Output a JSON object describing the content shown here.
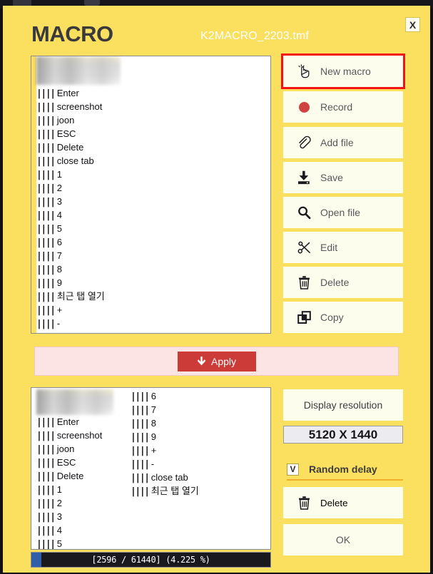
{
  "window": {
    "app_title": "MACRO",
    "file_name": "K2MACRO_2203.tmf",
    "close_label": "X"
  },
  "macro_list_top": {
    "bars": "||||",
    "items": [
      "Enter",
      "screenshot",
      "joon",
      "ESC",
      "Delete",
      "close tab",
      "1",
      "2",
      "3",
      "4",
      "5",
      "6",
      "7",
      "8",
      "9",
      "최근 탭 열기",
      "+",
      "-"
    ]
  },
  "macro_list_bottom": {
    "bars": "||||",
    "left_column": [
      "Enter",
      "screenshot",
      "joon",
      "ESC",
      "Delete",
      "1",
      "2",
      "3",
      "4",
      "5"
    ],
    "right_column": [
      "6",
      "7",
      "8",
      "9",
      "+",
      "-",
      "close tab",
      "최근 탭 열기"
    ]
  },
  "status": {
    "text": "[2596 / 61440] (4.225 %)",
    "current": 2596,
    "total": 61440,
    "percent": 4.225
  },
  "actions": [
    {
      "label": "New macro",
      "icon": "pointer-hand-icon",
      "highlighted": true
    },
    {
      "label": "Record",
      "icon": "record-dot-icon",
      "highlighted": false
    },
    {
      "label": "Add file",
      "icon": "paperclip-icon",
      "highlighted": false
    },
    {
      "label": "Save",
      "icon": "save-download-icon",
      "highlighted": false
    },
    {
      "label": "Open file",
      "icon": "magnifier-icon",
      "highlighted": false
    },
    {
      "label": "Edit",
      "icon": "scissors-icon",
      "highlighted": false
    },
    {
      "label": "Delete",
      "icon": "trash-icon",
      "highlighted": false
    },
    {
      "label": "Copy",
      "icon": "copy-squares-icon",
      "highlighted": false
    }
  ],
  "apply": {
    "label": "Apply",
    "icon": "down-arrow-icon"
  },
  "display": {
    "resolution_button_label": "Display resolution",
    "resolution_value": "5120 X 1440"
  },
  "random_delay": {
    "label": "Random delay",
    "checkbox_mark": "V",
    "checked": true
  },
  "bottom_actions": {
    "delete_label": "Delete",
    "delete_icon": "trash-icon",
    "ok_label": "OK"
  },
  "colors": {
    "window_bg": "#fbdf5f",
    "button_bg": "#fdfdee",
    "highlight_border": "#f21414",
    "apply_btn": "#cc3b38",
    "apply_band": "#fce4e4",
    "progress_fill": "#2f5fa8",
    "statusbar_bg": "#1a1a1e"
  }
}
